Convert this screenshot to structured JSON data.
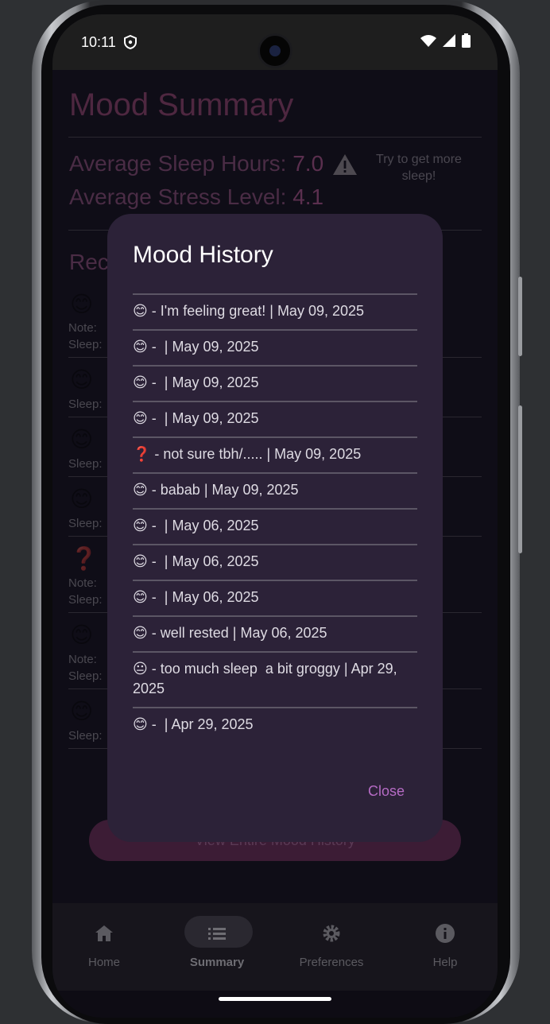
{
  "status_bar": {
    "time": "10:11"
  },
  "background_app": {
    "title": "Mood Summary",
    "avg_sleep_label": "Average Sleep Hours:",
    "avg_sleep_value": "7.0",
    "avg_stress_label": "Average Stress Level:",
    "avg_stress_value": "4.1",
    "tip": "Try to get more sleep!",
    "recent_label": "Rec",
    "note_prefix": "Note:",
    "sleep_prefix": "Sleep:",
    "view_all_button": "View Entire Mood History"
  },
  "dialog": {
    "title": "Mood History",
    "entries": [
      "😊 - I'm feeling great! | May 09, 2025",
      "😊 -  | May 09, 2025",
      "😊 -  | May 09, 2025",
      "😊 -  | May 09, 2025",
      "❓ - not sure tbh/..... | May 09, 2025",
      "😊 - babab | May 09, 2025",
      "😊 -  | May 06, 2025",
      "😊 -  | May 06, 2025",
      "😊 -  | May 06, 2025",
      "😊 - well rested | May 06, 2025",
      "😐 - too much sleep  a bit groggy | Apr 29, 2025",
      "😊 -  | Apr 29, 2025"
    ],
    "close_label": "Close"
  },
  "nav": {
    "items": [
      {
        "label": "Home",
        "icon": "home-icon"
      },
      {
        "label": "Summary",
        "icon": "list-icon"
      },
      {
        "label": "Preferences",
        "icon": "gear-icon"
      },
      {
        "label": "Help",
        "icon": "info-icon"
      }
    ],
    "active": "Summary"
  }
}
